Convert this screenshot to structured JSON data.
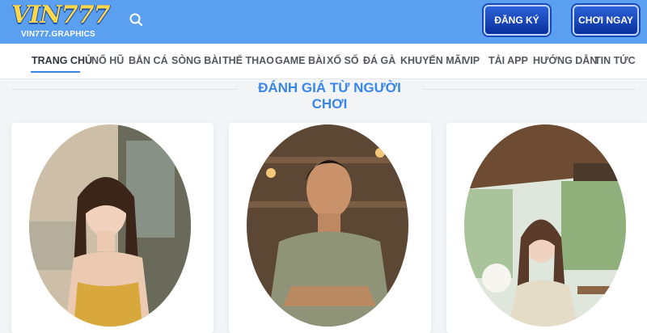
{
  "header": {
    "logo_text": "VIN777",
    "logo_sub": "VIN777.GRAPHICS",
    "search_icon": "search-icon",
    "register_label": "ĐĂNG KÝ",
    "play_label": "CHƠI NGAY"
  },
  "nav": {
    "items": [
      {
        "label": "TRANG CHỦ"
      },
      {
        "label": "NỔ HŨ"
      },
      {
        "label": "BẮN CÁ"
      },
      {
        "label": "SÒNG BÀI"
      },
      {
        "label": "THỂ THAO"
      },
      {
        "label": "GAME BÀI"
      },
      {
        "label": "XỔ SỐ"
      },
      {
        "label": "ĐÁ GÀ"
      },
      {
        "label": "KHUYẾN MÃI"
      },
      {
        "label": "VIP"
      },
      {
        "label": "TẢI APP"
      },
      {
        "label": "HƯỚNG DẪN"
      },
      {
        "label": "TIN TỨC"
      }
    ],
    "active_index": 0
  },
  "section": {
    "title": "ĐÁNH GIÁ TỪ NGƯỜI CHƠI"
  },
  "colors": {
    "header_bg": "#5b9ff0",
    "accent": "#3a86e8",
    "button_bg": "#0a2f9c",
    "logo_gold": "#ffd84a"
  }
}
